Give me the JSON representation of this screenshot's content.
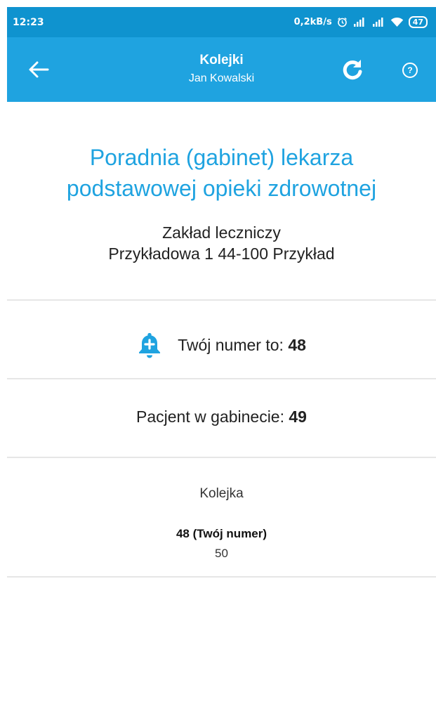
{
  "status_bar": {
    "time": "12:23",
    "network_speed": "0,2kB/s",
    "battery": "47"
  },
  "app_bar": {
    "title": "Kolejki",
    "subtitle": "Jan Kowalski",
    "back_icon": "arrow-left-icon",
    "refresh_icon": "refresh-icon",
    "help_icon": "help-icon",
    "help_symbol": "?"
  },
  "clinic": {
    "name_line1": "Poradnia (gabinet) lekarza",
    "name_line2": "podstawowej opieki zdrowotnej",
    "facility": "Zakład leczniczy",
    "address": "Przykładowa 1 44-100 Przykład"
  },
  "my_number": {
    "label": "Twój numer to: ",
    "value": "48",
    "icon": "bell-plus-icon"
  },
  "patient_in_office": {
    "label": "Pacjent w gabinecie: ",
    "value": "49"
  },
  "queue": {
    "title": "Kolejka",
    "items": [
      "48 (Twój numer)",
      "50"
    ]
  },
  "colors": {
    "app_bar": "#1fa3e0",
    "status_bar": "#0f93cf",
    "accent": "#1fa3e0",
    "divider": "#e6e6e6"
  }
}
